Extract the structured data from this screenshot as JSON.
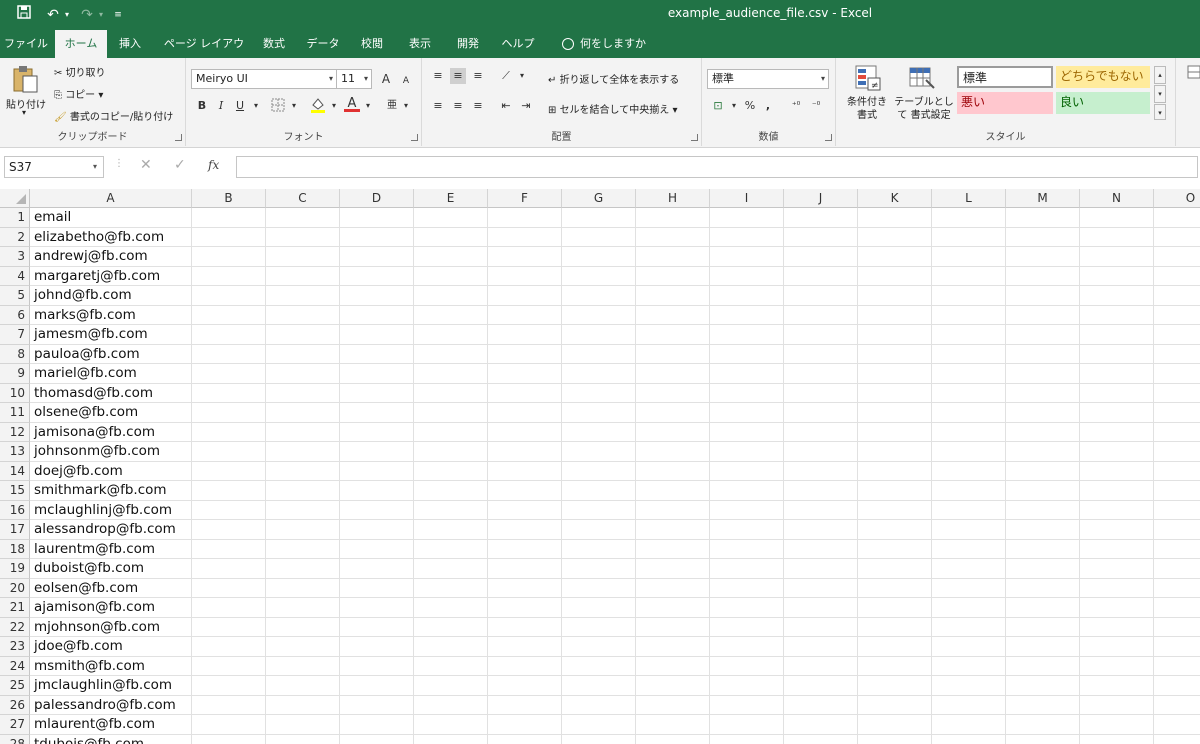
{
  "window": {
    "title": "example_audience_file.csv  -  Excel"
  },
  "tabs": [
    "ファイル",
    "ホーム",
    "挿入",
    "ページ レイアウト",
    "数式",
    "データ",
    "校閲",
    "表示",
    "開発",
    "ヘルプ"
  ],
  "tellme": "何をしますか",
  "clipboard": {
    "paste": "貼り付け",
    "cut": "切り取り",
    "copy": "コピー",
    "format_painter": "書式のコピー/貼り付け",
    "label": "クリップボード"
  },
  "font": {
    "name": "Meiryo UI",
    "size": "11",
    "label": "フォント",
    "bold": "B",
    "italic": "I",
    "underline": "U",
    "grow": "A",
    "shrink": "A",
    "color_letter": "A"
  },
  "alignment": {
    "wrap": "折り返して全体を表示する",
    "merge": "セルを結合して中央揃え",
    "label": "配置"
  },
  "number": {
    "format": "標準",
    "percent": "%",
    "comma": ",",
    "label": "数値"
  },
  "styles": {
    "conditional": "条件付き 書式",
    "table": "テーブルとして 書式設定",
    "normal": "標準",
    "neutral": "どちらでもない",
    "bad": "悪い",
    "good": "良い",
    "label": "スタイル"
  },
  "formula_bar": {
    "name_box": "S37",
    "fx": "fx"
  },
  "columns": [
    "A",
    "B",
    "C",
    "D",
    "E",
    "F",
    "G",
    "H",
    "I",
    "J",
    "K",
    "L",
    "M",
    "N",
    "O"
  ],
  "rows": [
    {
      "n": "1",
      "a": "email"
    },
    {
      "n": "2",
      "a": "elizabetho@fb.com"
    },
    {
      "n": "3",
      "a": "andrewj@fb.com"
    },
    {
      "n": "4",
      "a": "margaretj@fb.com"
    },
    {
      "n": "5",
      "a": "johnd@fb.com"
    },
    {
      "n": "6",
      "a": "marks@fb.com"
    },
    {
      "n": "7",
      "a": "jamesm@fb.com"
    },
    {
      "n": "8",
      "a": "pauloa@fb.com"
    },
    {
      "n": "9",
      "a": "mariel@fb.com"
    },
    {
      "n": "10",
      "a": "thomasd@fb.com"
    },
    {
      "n": "11",
      "a": "olsene@fb.com"
    },
    {
      "n": "12",
      "a": "jamisona@fb.com"
    },
    {
      "n": "13",
      "a": "johnsonm@fb.com"
    },
    {
      "n": "14",
      "a": "doej@fb.com"
    },
    {
      "n": "15",
      "a": "smithmark@fb.com"
    },
    {
      "n": "16",
      "a": "mclaughlinj@fb.com"
    },
    {
      "n": "17",
      "a": "alessandrop@fb.com"
    },
    {
      "n": "18",
      "a": "laurentm@fb.com"
    },
    {
      "n": "19",
      "a": "duboist@fb.com"
    },
    {
      "n": "20",
      "a": "eolsen@fb.com"
    },
    {
      "n": "21",
      "a": "ajamison@fb.com"
    },
    {
      "n": "22",
      "a": "mjohnson@fb.com"
    },
    {
      "n": "23",
      "a": "jdoe@fb.com"
    },
    {
      "n": "24",
      "a": "msmith@fb.com"
    },
    {
      "n": "25",
      "a": "jmclaughlin@fb.com"
    },
    {
      "n": "26",
      "a": "palessandro@fb.com"
    },
    {
      "n": "27",
      "a": "mlaurent@fb.com"
    },
    {
      "n": "28",
      "a": "tdubois@fb.com"
    }
  ]
}
